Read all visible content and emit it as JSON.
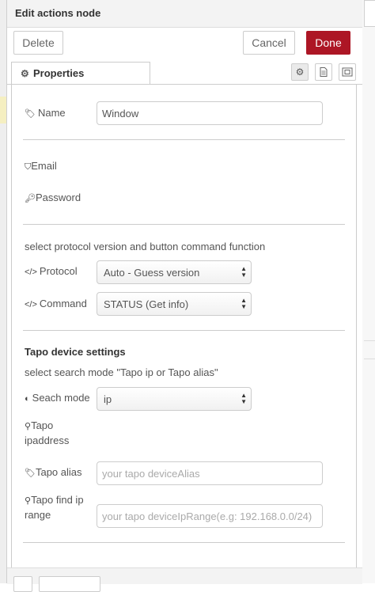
{
  "header": {
    "title": "Edit actions node"
  },
  "buttons": {
    "delete": "Delete",
    "cancel": "Cancel",
    "done": "Done"
  },
  "tabs": {
    "properties": "Properties"
  },
  "form": {
    "name_label": "Name",
    "name_value": "Window",
    "email_label": "Email",
    "password_label": "Password",
    "protocol_heading": "select protocol version and button command function",
    "protocol_label": "Protocol",
    "protocol_value": "Auto - Guess version",
    "command_label": "Command",
    "command_value": "STATUS (Get info)",
    "tapo_heading": "Tapo device settings",
    "search_heading": "select search mode \"Tapo ip or Tapo alias\"",
    "search_mode_label": "Seach mode",
    "search_mode_value": "ip",
    "tapo_ip_label_1": "Tapo",
    "tapo_ip_label_2": "ipaddress",
    "tapo_alias_label": "Tapo alias",
    "tapo_alias_placeholder": "your tapo deviceAlias",
    "tapo_find_label_1": "Tapo find ip",
    "tapo_find_label_2": "range",
    "tapo_find_placeholder": "your tapo deviceIpRange(e.g: 192.168.0.0/24)"
  },
  "colors": {
    "done_button": "#ad1625",
    "header_bg": "#f3f3f3"
  },
  "icons": [
    "gear-icon",
    "tag-icon",
    "shield-icon",
    "key-icon",
    "code-icon",
    "half-circle-icon",
    "map-marker-icon",
    "document-icon",
    "frame-icon"
  ]
}
